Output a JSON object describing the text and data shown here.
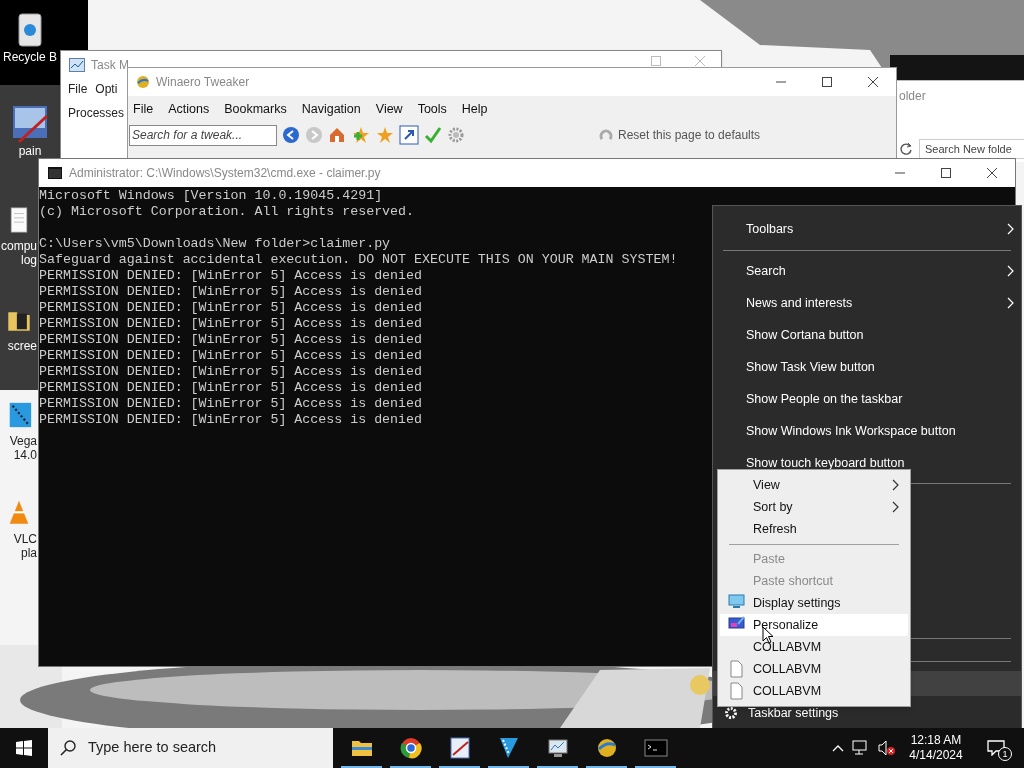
{
  "desktop_icons": [
    {
      "kind": "recycle",
      "lines": [
        "Recycle B"
      ]
    },
    {
      "kind": "paint",
      "lines": [
        "pain"
      ]
    },
    {
      "kind": "document",
      "lines": [
        "compu",
        "log"
      ]
    },
    {
      "kind": "folder",
      "lines": [
        "scree"
      ]
    },
    {
      "kind": "vegas",
      "lines": [
        "Vega",
        "14.0"
      ]
    },
    {
      "kind": "vlc",
      "lines": [
        "VLC",
        "pla"
      ]
    }
  ],
  "task_manager": {
    "title": "Task M",
    "menu": [
      "File",
      "Opti"
    ],
    "tab": "Processes"
  },
  "winaero": {
    "title": "Winaero Tweaker",
    "menu": [
      "File",
      "Actions",
      "Bookmarks",
      "Navigation",
      "View",
      "Tools",
      "Help"
    ],
    "search": {
      "placeholder": "Search for a tweak..."
    },
    "reset_button": "Reset this page to defaults"
  },
  "explorer": {
    "title": "older",
    "search": {
      "placeholder": "Search New folde"
    }
  },
  "cmd": {
    "title": "Administrator: C:\\Windows\\System32\\cmd.exe - claimer.py",
    "blocks": [
      [
        "Microsoft Windows [Version 10.0.19045.4291]",
        "(c) Microsoft Corporation. All rights reserved."
      ],
      [
        "C:\\Users\\vm5\\Downloads\\New folder>claimer.py",
        "Safeguard against accidental execution. DO NOT EXECUTE THIS ON YOUR MAIN SYSTEM!",
        "PERMISSION DENIED: [WinError 5] Access is denied",
        "PERMISSION DENIED: [WinError 5] Access is denied",
        "PERMISSION DENIED: [WinError 5] Access is denied",
        "PERMISSION DENIED: [WinError 5] Access is denied",
        "PERMISSION DENIED: [WinError 5] Access is denied",
        "PERMISSION DENIED: [WinError 5] Access is denied",
        "PERMISSION DENIED: [WinError 5] Access is denied",
        "PERMISSION DENIED: [WinError 5] Access is denied",
        "PERMISSION DENIED: [WinError 5] Access is denied",
        "PERMISSION DENIED: [WinError 5] Access is denied"
      ]
    ]
  },
  "taskbar_menu": {
    "items": [
      {
        "kind": "item",
        "label": "Toolbars",
        "submenu": true
      },
      {
        "kind": "separator"
      },
      {
        "kind": "item",
        "label": "Search",
        "submenu": true
      },
      {
        "kind": "item",
        "label": "News and interests",
        "submenu": true
      },
      {
        "kind": "item",
        "label": "Show Cortana button",
        "submenu": false
      },
      {
        "kind": "item",
        "label": "Show Task View button",
        "submenu": false
      },
      {
        "kind": "item",
        "label": "Show People on the taskbar",
        "submenu": false
      },
      {
        "kind": "item",
        "label": "Show Windows Ink Workspace button",
        "submenu": false
      },
      {
        "kind": "item",
        "label": "Show touch keyboard button",
        "submenu": false
      }
    ],
    "settings": "Taskbar settings"
  },
  "desktop_menu": {
    "items": [
      {
        "kind": "plain",
        "label": "View",
        "submenu": true,
        "disabled": false,
        "selected": false
      },
      {
        "kind": "plain",
        "label": "Sort by",
        "submenu": true,
        "disabled": false,
        "selected": false
      },
      {
        "kind": "plain",
        "label": "Refresh",
        "submenu": false,
        "disabled": false,
        "selected": false
      },
      {
        "kind": "separator"
      },
      {
        "kind": "plain",
        "label": "Paste",
        "submenu": false,
        "disabled": true,
        "selected": false
      },
      {
        "kind": "plain",
        "label": "Paste shortcut",
        "submenu": false,
        "disabled": true,
        "selected": false
      },
      {
        "kind": "display",
        "label": "Display settings",
        "submenu": false,
        "disabled": false,
        "selected": false
      },
      {
        "kind": "personalize",
        "label": "Personalize",
        "submenu": false,
        "disabled": false,
        "selected": true
      },
      {
        "kind": "plain",
        "label": "COLLABVM",
        "submenu": false,
        "disabled": false,
        "selected": false
      },
      {
        "kind": "file",
        "label": "COLLABVM",
        "submenu": false,
        "disabled": false,
        "selected": false
      },
      {
        "kind": "file",
        "label": "COLLABVM",
        "submenu": false,
        "disabled": false,
        "selected": false
      }
    ]
  },
  "taskbar": {
    "search": {
      "placeholder": "Type here to search"
    },
    "apps": [
      {
        "kind": "explorer",
        "running": true
      },
      {
        "kind": "chrome",
        "running": true
      },
      {
        "kind": "paint",
        "running": true
      },
      {
        "kind": "vegas",
        "running": true
      },
      {
        "kind": "taskmgr",
        "running": true
      },
      {
        "kind": "winaero",
        "running": true
      },
      {
        "kind": "cmd",
        "running": true
      }
    ],
    "clock": {
      "time": "12:18 AM",
      "date": "4/14/2024"
    },
    "notifications": "1"
  }
}
